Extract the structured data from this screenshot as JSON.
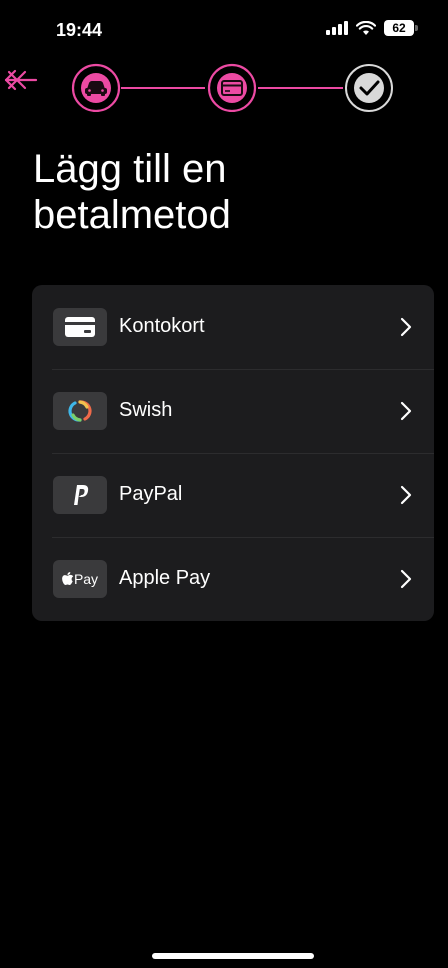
{
  "status": {
    "time": "19:44",
    "battery": "62"
  },
  "colors": {
    "accent": "#ec4aa3",
    "check": "#d9d9d9",
    "card_bg": "#1c1c1e"
  },
  "page": {
    "title": "Lägg till en\nbetalmetod"
  },
  "methods": [
    {
      "label": "Kontokort",
      "icon": "credit-card-icon"
    },
    {
      "label": "Swish",
      "icon": "swish-logo-icon"
    },
    {
      "label": "PayPal",
      "icon": "paypal-logo-icon"
    },
    {
      "label": "Apple Pay",
      "icon": "apple-pay-icon",
      "icon_text": "Pay"
    }
  ]
}
